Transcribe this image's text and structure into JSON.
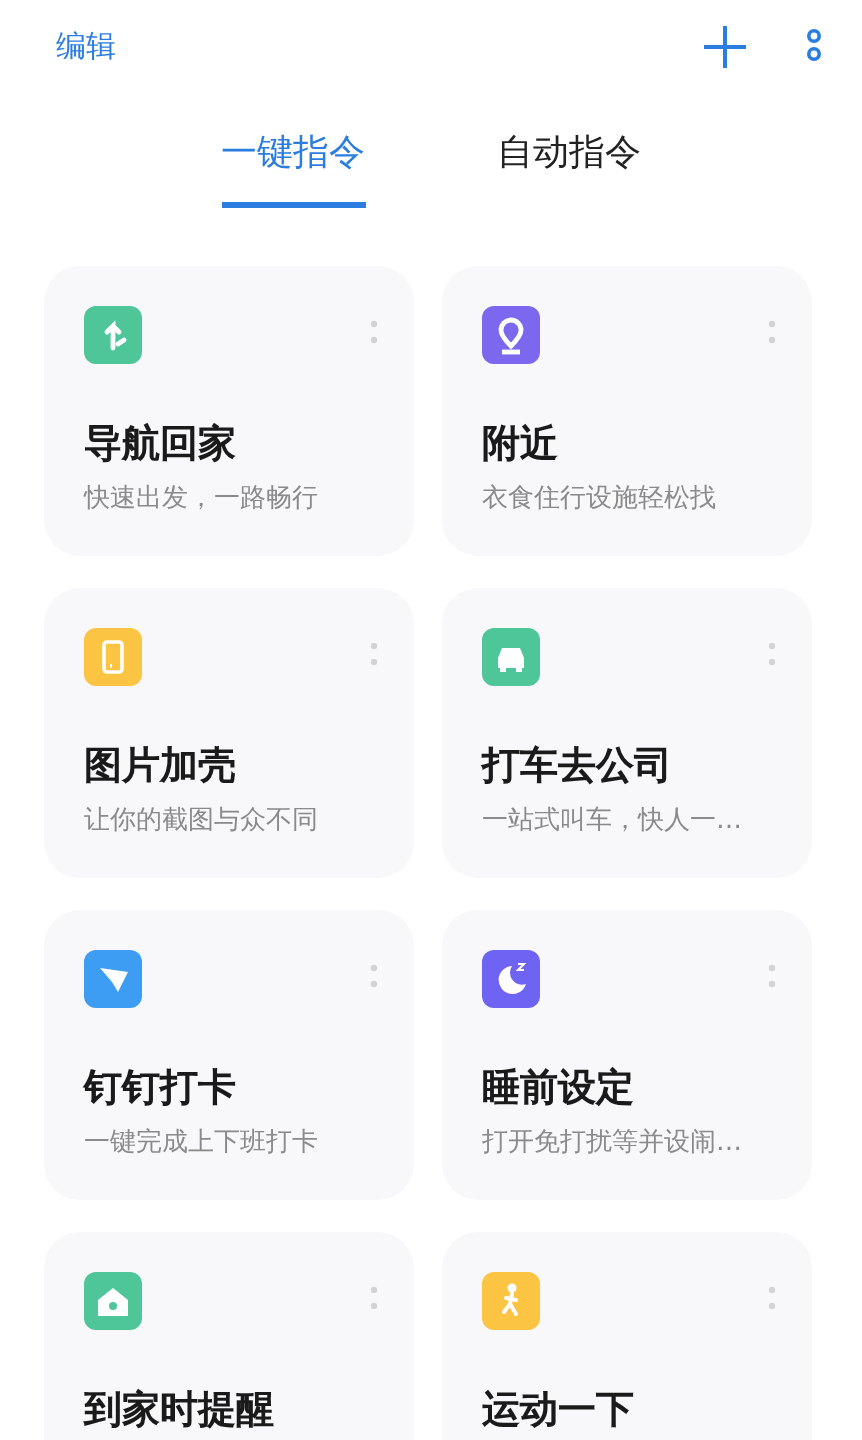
{
  "header": {
    "edit": "编辑"
  },
  "tabs": [
    {
      "label": "一键指令",
      "selected": true
    },
    {
      "label": "自动指令",
      "selected": false
    }
  ],
  "cards": [
    {
      "title": "导航回家",
      "subtitle": "快速出发，一路畅行",
      "kind": "navigate",
      "color": "#4fc59a"
    },
    {
      "title": "附近",
      "subtitle": "衣食住行设施轻松找",
      "kind": "pin",
      "color": "#7b68ee"
    },
    {
      "title": "图片加壳",
      "subtitle": "让你的截图与众不同",
      "kind": "phone",
      "color": "#fcc443"
    },
    {
      "title": "打车去公司",
      "subtitle": "一站式叫车，快人一…",
      "kind": "car",
      "color": "#4fc59a"
    },
    {
      "title": "钉钉打卡",
      "subtitle": "一键完成上下班打卡",
      "kind": "plane",
      "color": "#3d9df2"
    },
    {
      "title": "睡前设定",
      "subtitle": "打开免打扰等并设闹…",
      "kind": "moon",
      "color": "#6e63f2"
    },
    {
      "title": "到家时提醒",
      "kind": "home",
      "color": "#4fc59a"
    },
    {
      "title": "运动一下",
      "kind": "walk",
      "color": "#fcc443"
    }
  ]
}
